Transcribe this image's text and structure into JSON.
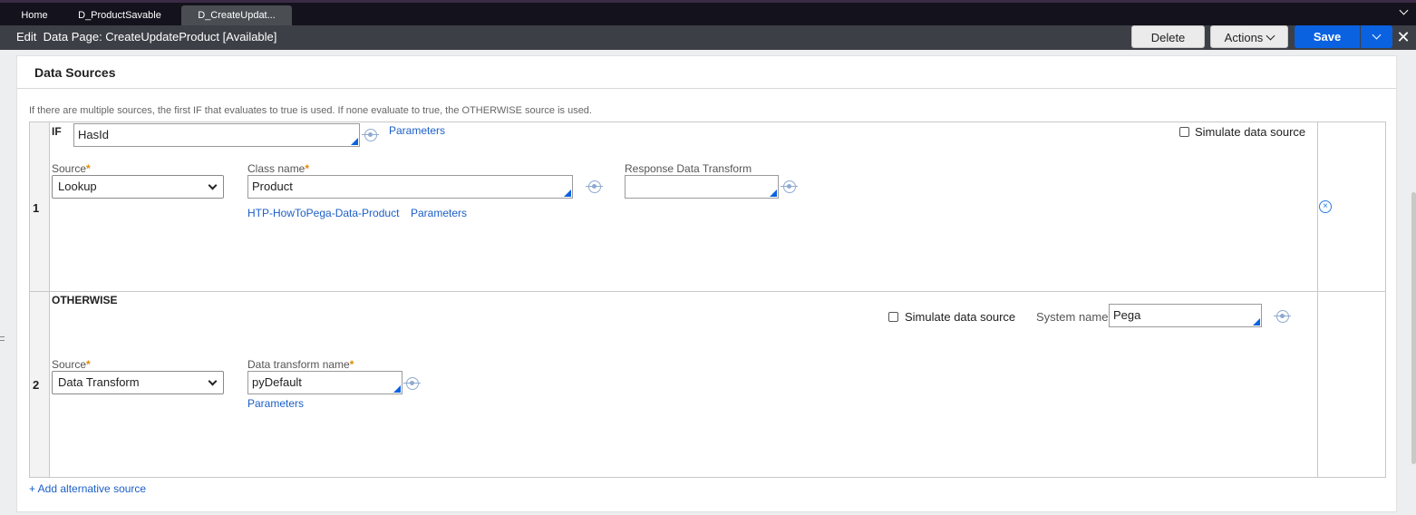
{
  "tabs": [
    {
      "label": "Home"
    },
    {
      "label": "D_ProductSavable"
    },
    {
      "label": "D_CreateUpdat..."
    }
  ],
  "header": {
    "edit_prefix": "Edit",
    "title": "Data Page: CreateUpdateProduct [Available]",
    "delete_label": "Delete",
    "actions_label": "Actions",
    "save_label": "Save"
  },
  "section": {
    "title": "Data Sources",
    "hint": "If there are multiple sources, the first IF that evaluates to true is used. If none evaluate to true, the OTHERWISE source is used."
  },
  "row1": {
    "number": "1",
    "keyword": "IF",
    "condition_value": "HasId",
    "condition_params_link": "Parameters",
    "simulate_label": "Simulate data source",
    "source_label": "Source",
    "source_value": "Lookup",
    "class_label": "Class name",
    "class_value": "Product",
    "class_link": "HTP-HowToPega-Data-Product",
    "class_params_link": "Parameters",
    "response_label": "Response Data Transform",
    "response_value": ""
  },
  "row2": {
    "number": "2",
    "keyword": "OTHERWISE",
    "simulate_label": "Simulate data source",
    "system_label": "System name",
    "system_value": "Pega",
    "source_label": "Source",
    "source_value": "Data Transform",
    "dt_label": "Data transform name",
    "dt_value": "pyDefault",
    "dt_params_link": "Parameters"
  },
  "add_link": "+ Add alternative source",
  "colors": {
    "accent": "#0a62e0",
    "link": "#1b5fc8",
    "required": "#e08a00",
    "header_bg": "#3c3f45"
  }
}
